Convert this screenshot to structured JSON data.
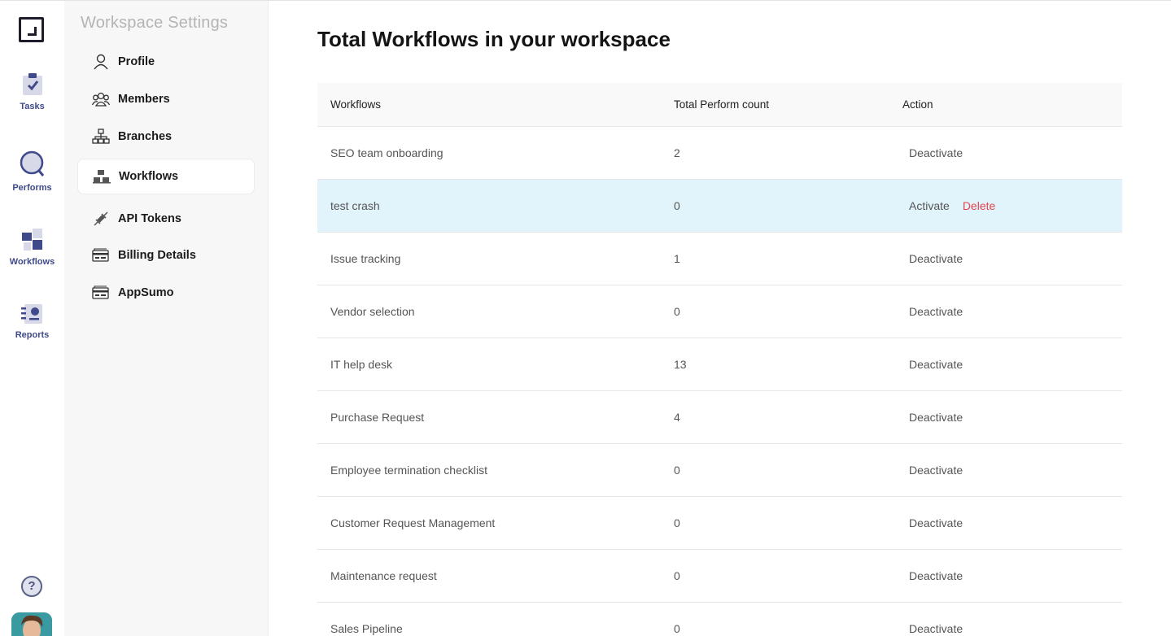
{
  "rail": {
    "items": [
      {
        "label": "Tasks",
        "icon": "clipboard-check-icon"
      },
      {
        "label": "Performs",
        "icon": "magnifier-icon"
      },
      {
        "label": "Workflows",
        "icon": "flowchart-icon"
      },
      {
        "label": "Reports",
        "icon": "report-icon"
      }
    ],
    "help_glyph": "?"
  },
  "settings": {
    "title": "Workspace Settings",
    "items": [
      {
        "label": "Profile",
        "icon": "person-icon"
      },
      {
        "label": "Members",
        "icon": "group-icon"
      },
      {
        "label": "Branches",
        "icon": "hierarchy-icon"
      },
      {
        "label": "Workflows",
        "icon": "workflow-icon",
        "active": true
      },
      {
        "label": "API Tokens",
        "icon": "plug-icon"
      },
      {
        "label": "Billing Details",
        "icon": "billing-card-icon"
      },
      {
        "label": "AppSumo",
        "icon": "billing-card-icon"
      }
    ]
  },
  "main": {
    "title": "Total Workflows in your workspace",
    "table": {
      "headers": [
        "Workflows",
        "Total Perform count",
        "Action"
      ],
      "rows": [
        {
          "name": "SEO team onboarding",
          "count": "2",
          "action": "Deactivate"
        },
        {
          "name": "test crash",
          "count": "0",
          "action": "Activate",
          "delete": "Delete"
        },
        {
          "name": "Issue tracking",
          "count": "1",
          "action": "Deactivate"
        },
        {
          "name": "Vendor selection",
          "count": "0",
          "action": "Deactivate"
        },
        {
          "name": "IT help desk",
          "count": "13",
          "action": "Deactivate"
        },
        {
          "name": "Purchase Request",
          "count": "4",
          "action": "Deactivate"
        },
        {
          "name": "Employee termination checklist",
          "count": "0",
          "action": "Deactivate"
        },
        {
          "name": "Customer Request Management",
          "count": "0",
          "action": "Deactivate"
        },
        {
          "name": "Maintenance request",
          "count": "0",
          "action": "Deactivate"
        },
        {
          "name": "Sales Pipeline",
          "count": "0",
          "action": "Deactivate"
        }
      ]
    }
  },
  "colors": {
    "accent": "#3f4a8a",
    "highlight_row": "#e1f4fb",
    "delete": "#e2454f"
  }
}
